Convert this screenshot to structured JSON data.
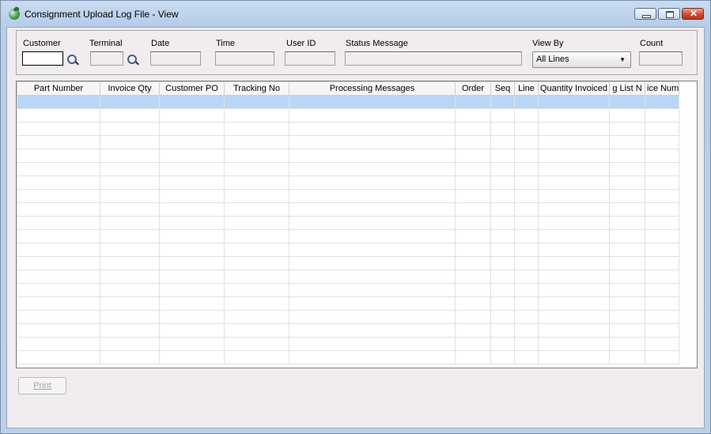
{
  "window": {
    "title": "Consignment Upload Log File - View",
    "icons": [
      "app-icon",
      "minimize-icon",
      "maximize-icon",
      "close-icon"
    ]
  },
  "filters": {
    "customer": {
      "label": "Customer",
      "value": ""
    },
    "terminal": {
      "label": "Terminal",
      "value": ""
    },
    "date": {
      "label": "Date",
      "value": ""
    },
    "time": {
      "label": "Time",
      "value": ""
    },
    "user_id": {
      "label": "User ID",
      "value": ""
    },
    "status_message": {
      "label": "Status Message",
      "value": ""
    },
    "view_by": {
      "label": "View By",
      "selected": "All Lines"
    },
    "count": {
      "label": "Count",
      "value": ""
    }
  },
  "grid": {
    "columns": [
      "Part Number",
      "Invoice Qty",
      "Customer PO",
      "Tracking No",
      "Processing Messages",
      "Order",
      "Seq",
      "Line",
      "Quantity Invoiced",
      "g List N",
      "ice Num"
    ],
    "rows": [
      [
        "",
        "",
        "",
        "",
        "",
        "",
        "",
        "",
        "",
        "",
        ""
      ],
      [
        "",
        "",
        "",
        "",
        "",
        "",
        "",
        "",
        "",
        "",
        ""
      ],
      [
        "",
        "",
        "",
        "",
        "",
        "",
        "",
        "",
        "",
        "",
        ""
      ],
      [
        "",
        "",
        "",
        "",
        "",
        "",
        "",
        "",
        "",
        "",
        ""
      ],
      [
        "",
        "",
        "",
        "",
        "",
        "",
        "",
        "",
        "",
        "",
        ""
      ],
      [
        "",
        "",
        "",
        "",
        "",
        "",
        "",
        "",
        "",
        "",
        ""
      ],
      [
        "",
        "",
        "",
        "",
        "",
        "",
        "",
        "",
        "",
        "",
        ""
      ],
      [
        "",
        "",
        "",
        "",
        "",
        "",
        "",
        "",
        "",
        "",
        ""
      ],
      [
        "",
        "",
        "",
        "",
        "",
        "",
        "",
        "",
        "",
        "",
        ""
      ],
      [
        "",
        "",
        "",
        "",
        "",
        "",
        "",
        "",
        "",
        "",
        ""
      ],
      [
        "",
        "",
        "",
        "",
        "",
        "",
        "",
        "",
        "",
        "",
        ""
      ],
      [
        "",
        "",
        "",
        "",
        "",
        "",
        "",
        "",
        "",
        "",
        ""
      ],
      [
        "",
        "",
        "",
        "",
        "",
        "",
        "",
        "",
        "",
        "",
        ""
      ],
      [
        "",
        "",
        "",
        "",
        "",
        "",
        "",
        "",
        "",
        "",
        ""
      ],
      [
        "",
        "",
        "",
        "",
        "",
        "",
        "",
        "",
        "",
        "",
        ""
      ],
      [
        "",
        "",
        "",
        "",
        "",
        "",
        "",
        "",
        "",
        "",
        ""
      ],
      [
        "",
        "",
        "",
        "",
        "",
        "",
        "",
        "",
        "",
        "",
        ""
      ],
      [
        "",
        "",
        "",
        "",
        "",
        "",
        "",
        "",
        "",
        "",
        ""
      ],
      [
        "",
        "",
        "",
        "",
        "",
        "",
        "",
        "",
        "",
        "",
        ""
      ],
      [
        "",
        "",
        "",
        "",
        "",
        "",
        "",
        "",
        "",
        "",
        ""
      ]
    ],
    "selected_row": 0,
    "selected_color": "#b9d7f5"
  },
  "buttons": {
    "print": "Print"
  }
}
